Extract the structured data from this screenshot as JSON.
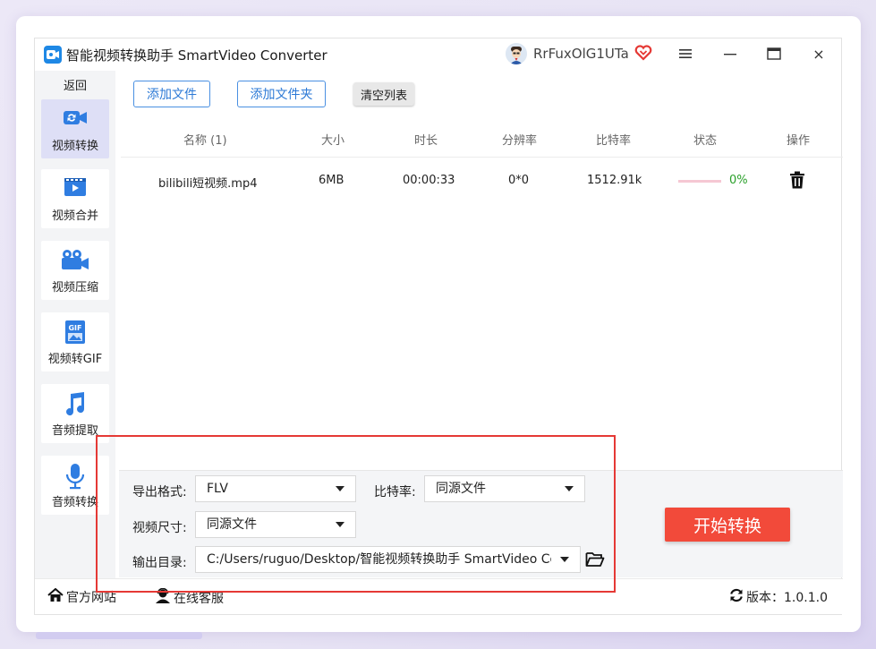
{
  "app": {
    "title": "智能视频转换助手 SmartVideo Converter",
    "username": "RrFuxOlG1UTa",
    "window_controls": [
      "menu-icon",
      "minimize-icon",
      "maximize-icon",
      "close-icon"
    ],
    "close_glyph": "×"
  },
  "sidebar": {
    "back_label": "返回",
    "items": [
      {
        "label": "视频转换",
        "icon": "video-convert-icon",
        "active": true
      },
      {
        "label": "视频合并",
        "icon": "video-merge-icon",
        "active": false
      },
      {
        "label": "视频压缩",
        "icon": "video-camera-icon",
        "active": false
      },
      {
        "label": "视频转GIF",
        "icon": "gif-icon",
        "active": false
      },
      {
        "label": "音频提取",
        "icon": "music-note-icon",
        "active": false
      },
      {
        "label": "音频转换",
        "icon": "microphone-icon",
        "active": false
      }
    ]
  },
  "toolbar": {
    "add_file": "添加文件",
    "add_folder": "添加文件夹",
    "clear_list": "清空列表"
  },
  "table": {
    "columns": [
      "名称 (1)",
      "大小",
      "时长",
      "分辨率",
      "比特率",
      "状态",
      "操作"
    ],
    "rows": [
      {
        "name": "bilibili短视频.mp4",
        "size": "6MB",
        "duration": "00:00:33",
        "resolution": "0*0",
        "bitrate": "1512.91k",
        "progress": 0,
        "progress_text": "0%",
        "action_icon": "trash-icon"
      }
    ]
  },
  "settings": {
    "format_label": "导出格式:",
    "format_value": "FLV",
    "bitrate_label": "比特率:",
    "bitrate_value": "同源文件",
    "size_label": "视频尺寸:",
    "size_value": "同源文件",
    "output_label": "输出目录:",
    "output_value": "C:/Users/ruguo/Desktop/智能视频转换助手 SmartVideo Converter",
    "start_button": "开始转换"
  },
  "footer": {
    "website": "官方网站",
    "support": "在线客服",
    "version": "版本：1.0.1.0"
  },
  "colors": {
    "accent_blue": "#2d7ad6",
    "start_red": "#f24a3a",
    "annotation_red": "#e53935",
    "progress_green": "#2aa02a"
  }
}
